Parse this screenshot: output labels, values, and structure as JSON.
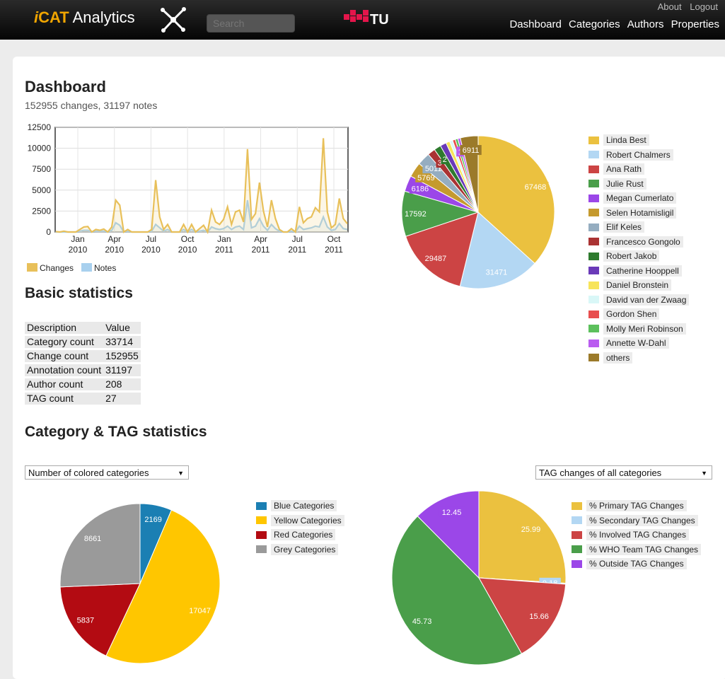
{
  "header": {
    "brand_i": "i",
    "brand_cat": "CAT",
    "brand_rest": " Analytics",
    "search_placeholder": "Search",
    "tugraz": "TU Graz",
    "top_links": [
      "About",
      "Logout"
    ],
    "nav": [
      "Dashboard",
      "Categories",
      "Authors",
      "Properties"
    ]
  },
  "dashboard": {
    "title": "Dashboard",
    "subtitle": "152955 changes, 31197 notes"
  },
  "basic": {
    "title": "Basic statistics",
    "header": [
      "Description",
      "Value"
    ],
    "rows": [
      [
        "Category count",
        "33714"
      ],
      [
        "Change count",
        "152955"
      ],
      [
        "Annotation count",
        "31197"
      ],
      [
        "Author count",
        "208"
      ],
      [
        "TAG count",
        "27"
      ]
    ]
  },
  "cat_section": {
    "title": "Category & TAG statistics",
    "left_select": "Number of colored categories",
    "right_select": "TAG changes of all categories"
  },
  "chart_data": [
    {
      "type": "line",
      "x_ticks": [
        "Jan\n2010",
        "Apr\n2010",
        "Jul\n2010",
        "Oct\n2010",
        "Jan\n2011",
        "Apr\n2011",
        "Jul\n2011",
        "Oct\n2011"
      ],
      "y_ticks": [
        "0",
        "2500",
        "5000",
        "7500",
        "10000",
        "12500"
      ],
      "ylim": [
        0,
        12500
      ],
      "series": [
        {
          "name": "Changes",
          "color": "#e8c05a",
          "values": [
            50,
            0,
            100,
            0,
            0,
            0,
            300,
            600,
            650,
            0,
            300,
            200,
            350,
            0,
            600,
            3800,
            3200,
            0,
            300,
            0,
            0,
            0,
            0,
            0,
            300,
            6200,
            1800,
            300,
            900,
            0,
            0,
            0,
            900,
            0,
            900,
            0,
            400,
            800,
            0,
            2600,
            1200,
            900,
            1500,
            3000,
            900,
            2400,
            2600,
            1200,
            9900,
            1500,
            2200,
            5900,
            2500,
            600,
            3800,
            1600,
            300,
            0,
            0,
            400,
            0,
            3000,
            1100,
            1600,
            1800,
            2900,
            2400,
            11200,
            2400,
            500,
            900,
            4000,
            1600,
            1000
          ]
        },
        {
          "name": "Notes",
          "color": "#a8d0ee",
          "values": [
            0,
            0,
            0,
            0,
            0,
            0,
            100,
            200,
            200,
            0,
            100,
            100,
            100,
            0,
            200,
            1100,
            800,
            0,
            100,
            0,
            0,
            0,
            0,
            0,
            100,
            900,
            500,
            100,
            300,
            0,
            0,
            0,
            300,
            0,
            300,
            0,
            100,
            200,
            0,
            600,
            400,
            300,
            400,
            700,
            300,
            600,
            700,
            300,
            3800,
            500,
            700,
            1600,
            700,
            200,
            900,
            400,
            100,
            0,
            0,
            100,
            0,
            700,
            300,
            400,
            500,
            700,
            600,
            1800,
            600,
            200,
            300,
            1000,
            400,
            300
          ]
        }
      ]
    },
    {
      "type": "pie",
      "labels": [
        "Linda Best",
        "Robert Chalmers",
        "Ana Rath",
        "Julie Rust",
        "Megan Cumerlato",
        "Selen Hotamisligil",
        "Elif Keles",
        "Francesco Gongolo",
        "Robert Jakob",
        "Catherine Hooppell",
        "Daniel Bronstein",
        "David van der Zwaag",
        "Gordon Shen",
        "Molly Meri Robinson",
        "Annette W-Dahl",
        "others"
      ],
      "values": [
        67468,
        31471,
        29487,
        17592,
        6186,
        5769,
        5011,
        3000,
        2700,
        2400,
        1500,
        1200,
        1100,
        1000,
        1000,
        6911
      ],
      "data_labels": [
        "67468",
        "31471",
        "29487",
        "17592",
        "6186",
        "5769",
        "5011",
        "3",
        "2",
        "",
        "",
        "",
        "",
        "",
        "10",
        "6911"
      ],
      "colors": [
        "#ebc13f",
        "#b3d7f3",
        "#cc4444",
        "#4a9e4a",
        "#9b47e8",
        "#c59a2e",
        "#95adc0",
        "#aa3333",
        "#2e7a2e",
        "#6a3ab8",
        "#f7e45a",
        "#d9f7f7",
        "#e84e4e",
        "#5cc05c",
        "#b95cf0",
        "#9b7a2a"
      ]
    },
    {
      "type": "pie",
      "labels": [
        "Blue Categories",
        "Yellow Categories",
        "Red Categories",
        "Grey Categories"
      ],
      "values": [
        2169,
        17047,
        5837,
        8661
      ],
      "colors": [
        "#1b7fb3",
        "#ffc600",
        "#b30b12",
        "#9a9a9a"
      ]
    },
    {
      "type": "pie",
      "labels": [
        "% Primary TAG Changes",
        "% Secondary TAG Changes",
        "% Involved TAG Changes",
        "% WHO Team TAG Changes",
        "% Outside TAG Changes"
      ],
      "values": [
        25.99,
        0.18,
        15.66,
        45.73,
        12.45
      ],
      "colors": [
        "#ebc13f",
        "#b3d7f3",
        "#cc4444",
        "#4a9e4a",
        "#9b47e8"
      ]
    }
  ]
}
